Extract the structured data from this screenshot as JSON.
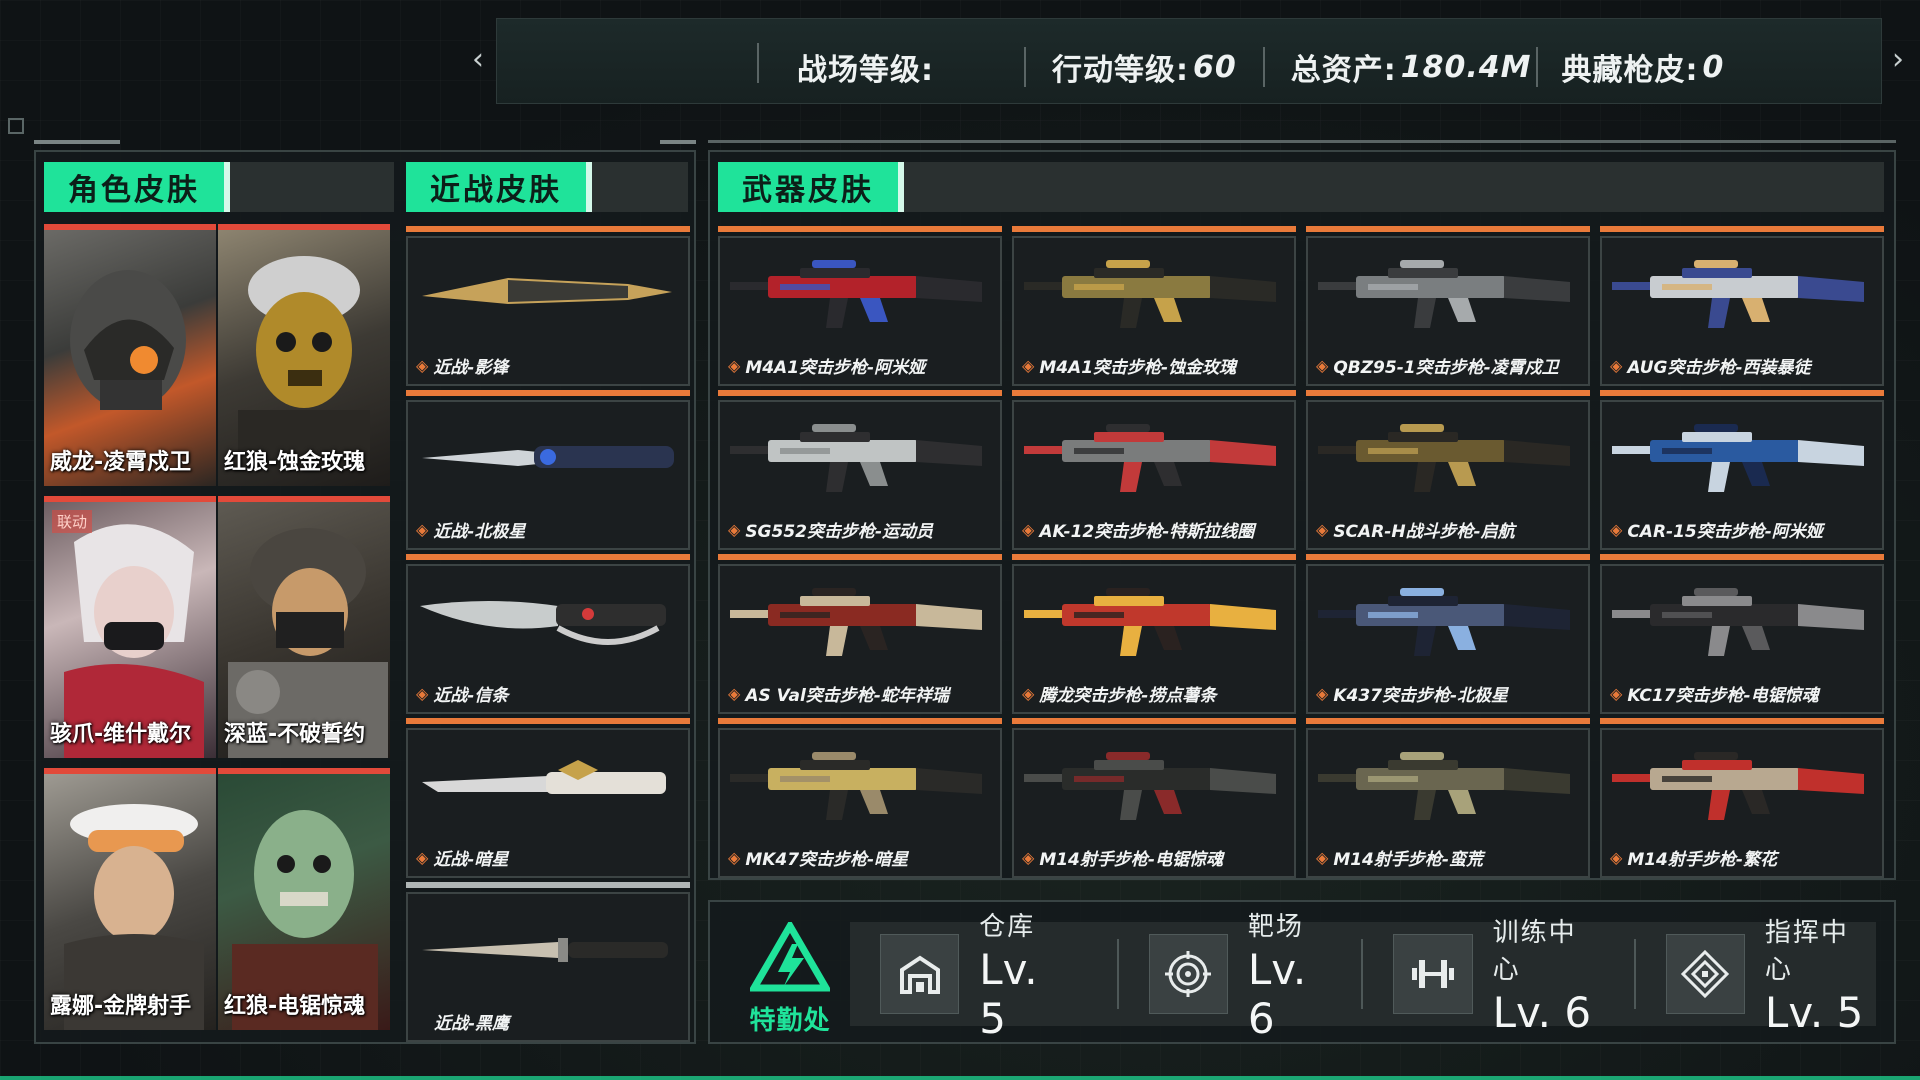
{
  "stats": {
    "battlefield_level_label": "战场等级:",
    "action_level_label": "行动等级:",
    "action_level_value": "60",
    "total_assets_label": "总资产:",
    "total_assets_value": "180.4M",
    "collection_label": "典藏枪皮:",
    "collection_value": "0"
  },
  "sections": {
    "character": "角色皮肤",
    "melee": "近战皮肤",
    "weapon": "武器皮肤"
  },
  "characters": [
    {
      "name": "威龙-凌霄戍卫",
      "tag": ""
    },
    {
      "name": "红狼-蚀金玫瑰",
      "tag": ""
    },
    {
      "name": "骇爪-维什戴尔",
      "tag": "联动"
    },
    {
      "name": "深蓝-不破誓约",
      "tag": ""
    },
    {
      "name": "露娜-金牌射手",
      "tag": ""
    },
    {
      "name": "红狼-电锯惊魂",
      "tag": ""
    }
  ],
  "melee": [
    {
      "name": "近战-影锋"
    },
    {
      "name": "近战-北极星"
    },
    {
      "name": "近战-信条"
    },
    {
      "name": "近战-暗星"
    },
    {
      "name": "近战-黑鹰"
    }
  ],
  "weapons": [
    {
      "name": "M4A1突击步枪-阿米娅"
    },
    {
      "name": "M4A1突击步枪-蚀金玫瑰"
    },
    {
      "name": "QBZ95-1突击步枪-凌霄戍卫"
    },
    {
      "name": "AUG突击步枪-西装暴徒"
    },
    {
      "name": "SG552突击步枪-运动员"
    },
    {
      "name": "AK-12突击步枪-特斯拉线圈"
    },
    {
      "name": "SCAR-H战斗步枪-启航"
    },
    {
      "name": "CAR-15突击步枪-阿米娅"
    },
    {
      "name": "AS Val突击步枪-蛇年祥瑞"
    },
    {
      "name": "腾龙突击步枪-捞点薯条"
    },
    {
      "name": "K437突击步枪-北极星"
    },
    {
      "name": "KC17突击步枪-电锯惊魂"
    },
    {
      "name": "MK47突击步枪-暗星"
    },
    {
      "name": "M14射手步枪-电锯惊魂"
    },
    {
      "name": "M14射手步枪-蛮荒"
    },
    {
      "name": "M14射手步枪-繁花"
    }
  ],
  "bottom": {
    "logo_text": "特勤处",
    "facilities": [
      {
        "name": "仓库",
        "level": "Lv. 5",
        "icon": "warehouse-icon"
      },
      {
        "name": "靶场",
        "level": "Lv. 6",
        "icon": "target-icon"
      },
      {
        "name": "训练中心",
        "level": "Lv. 6",
        "icon": "dumbbell-icon"
      },
      {
        "name": "指挥中心",
        "level": "Lv. 5",
        "icon": "command-icon"
      }
    ]
  },
  "colors": {
    "accent_green": "#1fe39a",
    "rarity_orange": "#e97a3a",
    "rarity_red": "#e24a3a",
    "rarity_gray": "#b0b6b6"
  }
}
